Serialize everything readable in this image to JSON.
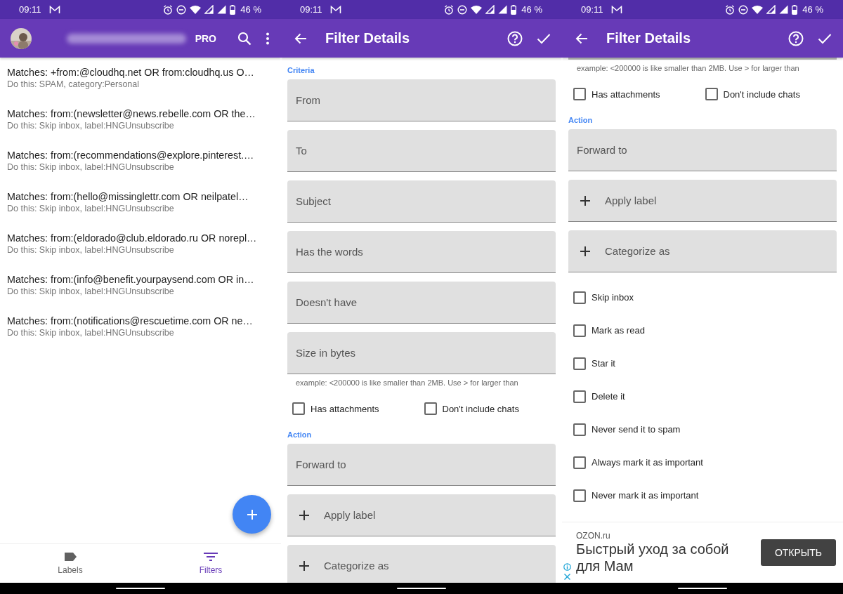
{
  "screens": [
    {
      "kind": "filter_list",
      "status_bar": {
        "time": "09:11",
        "battery": "46 %"
      },
      "app_bar": {
        "pro": "PRO"
      },
      "filters": [
        {
          "matches": "Matches: +from:@cloudhq.net OR from:cloudhq.us O…",
          "action": "Do this: SPAM, category:Personal"
        },
        {
          "matches": "Matches: from:(newsletter@news.rebelle.com OR the…",
          "action": "Do this: Skip inbox, label:HNGUnsubscribe"
        },
        {
          "matches": "Matches: from:(recommendations@explore.pinterest.…",
          "action": "Do this: Skip inbox, label:HNGUnsubscribe"
        },
        {
          "matches": "Matches: from:(hello@missinglettr.com OR neilpatel…",
          "action": "Do this: Skip inbox, label:HNGUnsubscribe"
        },
        {
          "matches": "Matches: from:(eldorado@club.eldorado.ru OR norepl…",
          "action": "Do this: Skip inbox, label:HNGUnsubscribe"
        },
        {
          "matches": "Matches: from:(info@benefit.yourpaysend.com OR in…",
          "action": "Do this: Skip inbox, label:HNGUnsubscribe"
        },
        {
          "matches": "Matches: from:(notifications@rescuetime.com OR ne…",
          "action": "Do this: Skip inbox, label:HNGUnsubscribe"
        }
      ],
      "bottom_nav": [
        {
          "label": "Labels",
          "selected": false
        },
        {
          "label": "Filters",
          "selected": true
        }
      ]
    },
    {
      "kind": "filter_details",
      "status_bar": {
        "time": "09:11",
        "battery": "46 %"
      },
      "title": "Filter Details",
      "items": [
        {
          "kind": "section",
          "text": "Criteria"
        },
        {
          "kind": "field",
          "placeholder": "From"
        },
        {
          "kind": "field",
          "placeholder": "To"
        },
        {
          "kind": "field",
          "placeholder": "Subject"
        },
        {
          "kind": "field",
          "placeholder": "Has the words"
        },
        {
          "kind": "field",
          "placeholder": "Doesn't have"
        },
        {
          "kind": "field",
          "placeholder": "Size in bytes"
        },
        {
          "kind": "hint",
          "text": "example: <200000 is like smaller than 2MB. Use > for larger than"
        },
        {
          "kind": "checkbox_pair",
          "items": [
            {
              "label": "Has attachments",
              "checked": false
            },
            {
              "label": "Don't include chats",
              "checked": false
            }
          ]
        },
        {
          "kind": "section",
          "text": "Action"
        },
        {
          "kind": "field",
          "placeholder": "Forward to"
        },
        {
          "kind": "add_field",
          "label": "Apply label"
        },
        {
          "kind": "add_field",
          "label": "Categorize as"
        }
      ]
    },
    {
      "kind": "filter_details",
      "status_bar": {
        "time": "09:11",
        "battery": "46 %"
      },
      "title": "Filter Details",
      "items": [
        {
          "kind": "field_edge"
        },
        {
          "kind": "hint",
          "text": "example: <200000 is like smaller than 2MB. Use > for larger than"
        },
        {
          "kind": "checkbox_pair",
          "items": [
            {
              "label": "Has attachments",
              "checked": false
            },
            {
              "label": "Don't include chats",
              "checked": false
            }
          ]
        },
        {
          "kind": "section",
          "text": "Action"
        },
        {
          "kind": "field",
          "placeholder": "Forward to"
        },
        {
          "kind": "add_field",
          "label": "Apply label"
        },
        {
          "kind": "add_field",
          "label": "Categorize as"
        },
        {
          "kind": "checkbox",
          "label": "Skip inbox",
          "checked": false
        },
        {
          "kind": "checkbox",
          "label": "Mark as read",
          "checked": false
        },
        {
          "kind": "checkbox",
          "label": "Star it",
          "checked": false
        },
        {
          "kind": "checkbox",
          "label": "Delete it",
          "checked": false
        },
        {
          "kind": "checkbox",
          "label": "Never send it to spam",
          "checked": false
        },
        {
          "kind": "checkbox",
          "label": "Always mark it as important",
          "checked": false
        },
        {
          "kind": "checkbox",
          "label": "Never mark it as important",
          "checked": false
        }
      ],
      "ad": {
        "advertiser": "OZON.ru",
        "headline": "Быстрый уход за собой для Мам",
        "button": "ОТКРЫТЬ"
      }
    }
  ]
}
